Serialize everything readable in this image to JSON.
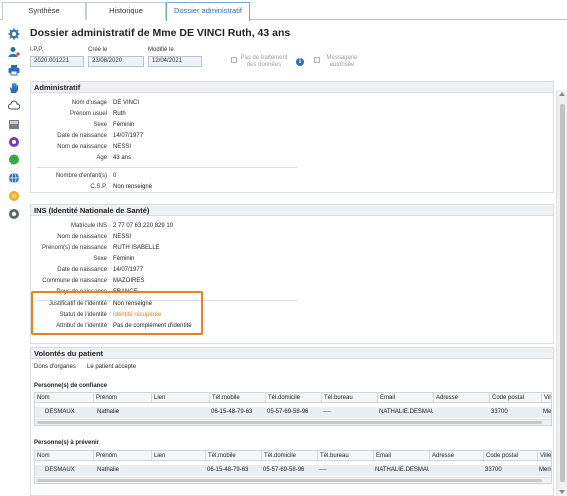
{
  "tabs": [
    {
      "label": "Synthèse"
    },
    {
      "label": "Historique"
    },
    {
      "label": "Dossier administratif"
    }
  ],
  "page_title": "Dossier administratif de Mme DE VINCI Ruth, 43 ans",
  "header_fields": {
    "ipp": {
      "label": "I.P.P.",
      "value": "2020.001221"
    },
    "cree_le": {
      "label": "Créé le",
      "value": "23/08/2020"
    },
    "modifie_le": {
      "label": "Modifié le",
      "value": "12/04/2021"
    },
    "pas_traitement": {
      "line1": "Pas de traitement",
      "line2": "des données"
    },
    "messagerie": {
      "line1": "Messagerie",
      "line2": "autorisée"
    }
  },
  "administratif": {
    "title": "Administratif",
    "rows": [
      {
        "label": "Nom d'usage",
        "value": "DE VINCI"
      },
      {
        "label": "Prénom usuel",
        "value": "Ruth"
      },
      {
        "label": "Sexe",
        "value": "Féminin"
      },
      {
        "label": "Date de naissance",
        "value": "14/07/1977"
      },
      {
        "label": "Nom de naissance",
        "value": "NESSI"
      },
      {
        "label": "Age",
        "value": "43 ans"
      }
    ],
    "rows2": [
      {
        "label": "Nombre d'enfant(s)",
        "value": "0"
      },
      {
        "label": "C.S.P.",
        "value": "Non renseigné"
      }
    ]
  },
  "ins": {
    "title": "INS (Identité Nationale de Santé)",
    "rows": [
      {
        "label": "Matricule INS",
        "value": "2 77 07 63 220 829 10"
      },
      {
        "label": "Nom de naissance",
        "value": "NESSI"
      },
      {
        "label": "Prénom(s) de naissance",
        "value": "RUTH ISABELLE"
      },
      {
        "label": "Sexe",
        "value": "Féminin"
      },
      {
        "label": "Date de naissance",
        "value": "14/07/1977"
      },
      {
        "label": "Commune de naissance",
        "value": "MAZOIRES"
      },
      {
        "label": "Pays de naissance",
        "value": "FRANCE"
      }
    ],
    "identity": [
      {
        "label": "Justificatif de l'identité",
        "value": "Non renseigné"
      },
      {
        "label": "Statut de l'identité",
        "value": "Identité récupérée"
      },
      {
        "label": "Attribut de l'identité",
        "value": "Pas de complément d'identité"
      }
    ]
  },
  "volontes": {
    "title": "Volontés du patient",
    "dons_label": "Dons d'organes",
    "dons_value": "Le patient accepte",
    "confiance": {
      "caption": "Personne(s) de confiance",
      "columns": [
        "Nom",
        "Prénom",
        "Lien",
        "Tél.mobile",
        "Tél.domicile",
        "Tél.bureau",
        "Email",
        "Adresse",
        "Code postal",
        "Ville"
      ],
      "rows": [
        [
          "DESMAUX",
          "Nathalie",
          "",
          "06-15-48-79-63",
          "05-57-69-58-96",
          "----",
          "NATHALIE.DESMAU...",
          "",
          "33700",
          "Me"
        ]
      ]
    },
    "prevenir": {
      "caption": "Personne(s) à prévenir",
      "columns": [
        "Nom",
        "Prénom",
        "Lien",
        "Tél.mobile",
        "Tél.domicile",
        "Tél.bureau",
        "Email",
        "Adresse",
        "Code postal",
        "Ville"
      ],
      "rows": [
        [
          "DESMAUX",
          "Nathalie",
          "",
          "06-15-48-79-63",
          "05-57-69-58-96",
          "----",
          "NATHALIE.DESMAU...",
          "",
          "33700",
          "Merign"
        ]
      ]
    }
  },
  "colors": {
    "accent": "#2a6fb8",
    "highlight_border": "#e8811f",
    "status_orange": "#e8811f"
  },
  "sidebar_icons": [
    "gear-icon",
    "user-key-icon",
    "printer-icon",
    "hand-icon",
    "cloud-icon",
    "card-reader-icon",
    "purple-circle-icon",
    "green-chat-icon",
    "blue-globe-icon",
    "orange-coin-icon",
    "gray-circle-icon"
  ]
}
